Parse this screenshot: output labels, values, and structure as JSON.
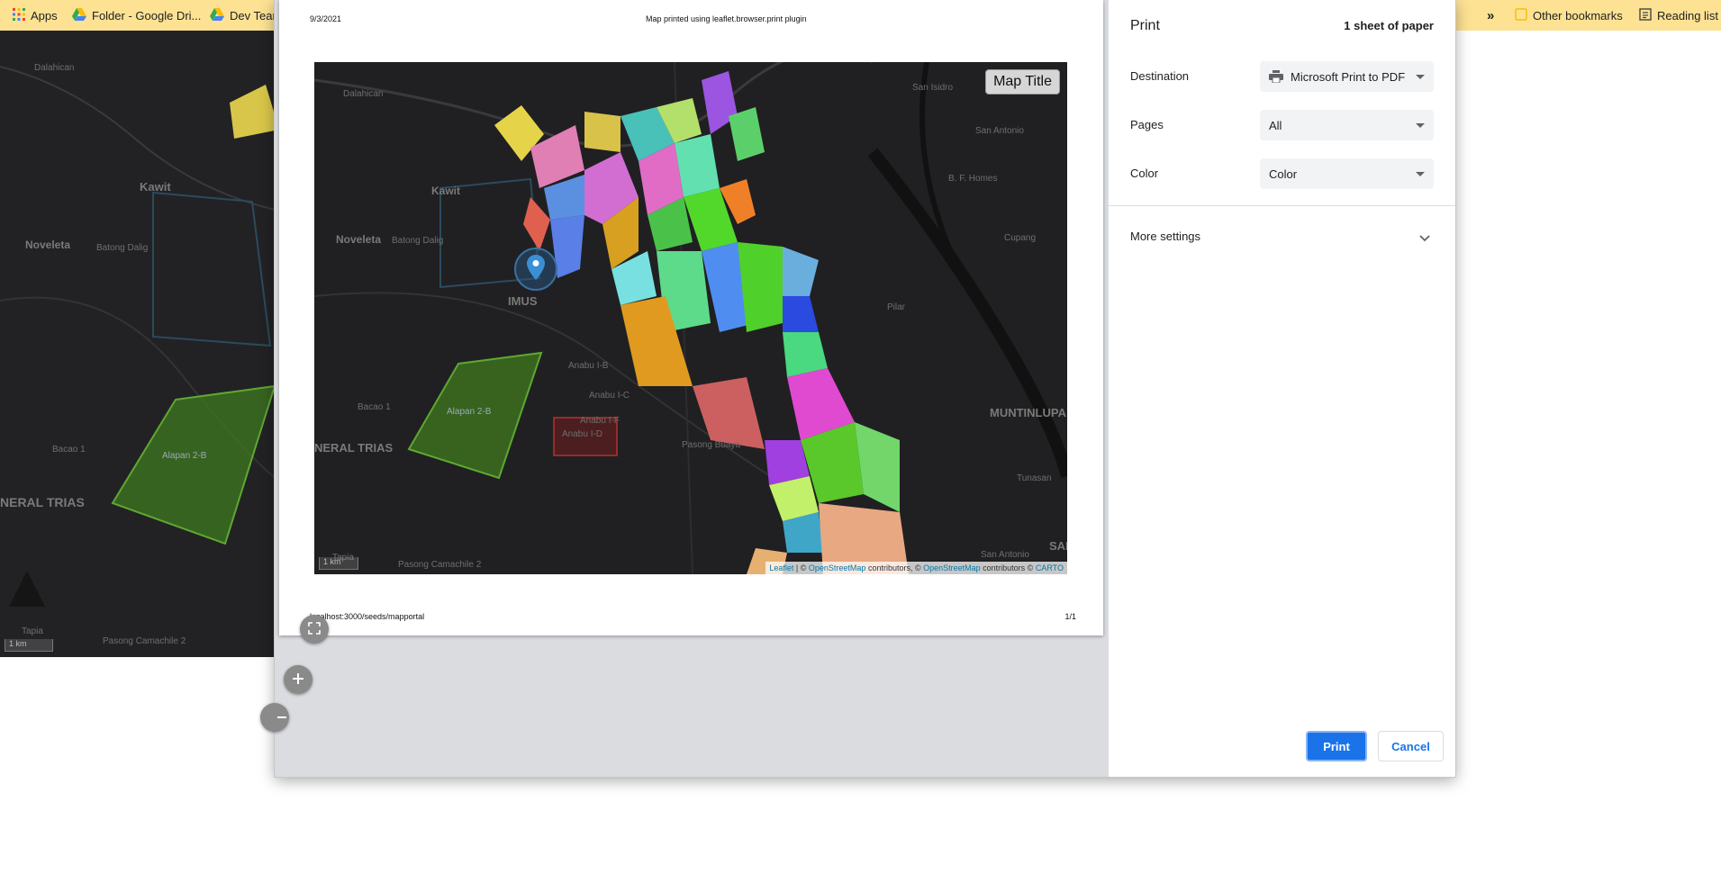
{
  "bookmarks": {
    "apps": "Apps",
    "folder": "Folder - Google Dri...",
    "dev_team": "Dev Team",
    "overflow": "»",
    "other": "Other bookmarks",
    "reading_list": "Reading list"
  },
  "background_map": {
    "labels": [
      "Dalahican",
      "Kawit",
      "Noveleta",
      "Batong Dalig",
      "Bacao 1",
      "Alapan 2-B",
      "NERAL TRIAS",
      "Tapia",
      "Pasong Camachile 2"
    ],
    "scale": "1 km"
  },
  "sheet": {
    "date": "9/3/2021",
    "header_title": "Map printed using leaflet.browser.print plugin",
    "footer_url": "localhost:3000/seeds/mapportal",
    "page_number": "1/1",
    "map": {
      "title_button": "Map Title",
      "scale": "1 km",
      "labels": [
        "Dalahican",
        "Kawit",
        "Noveleta",
        "Batong Dalig",
        "IMUS",
        "Anabu I-B",
        "Anabu I-C",
        "Anabu I-F",
        "Anabu I-D",
        "Alapan 2-B",
        "Bacao 1",
        "NERAL TRIAS",
        "Pasong Buaya",
        "Tapia",
        "Pasong Camachile 2",
        "San Isidro",
        "San Antonio",
        "B. F. Homes",
        "Cupang",
        "Pilar",
        "MUNTINLUPA",
        "Tunasan",
        "San Antonio",
        "SAN"
      ],
      "attribution": {
        "leaflet": "Leaflet",
        "sep1": " | © ",
        "osm1": "OpenStreetMap",
        "mid": " contributors, © ",
        "osm2": "OpenStreetMap",
        "mid2": " contributors © ",
        "carto": "CARTO"
      }
    }
  },
  "settings": {
    "title": "Print",
    "sheets": "1 sheet of paper",
    "destination_label": "Destination",
    "destination_value": "Microsoft Print to PDF",
    "pages_label": "Pages",
    "pages_value": "All",
    "color_label": "Color",
    "color_value": "Color",
    "more_settings": "More settings",
    "print_button": "Print",
    "cancel_button": "Cancel"
  },
  "colors": {
    "bookmark_bar": "#fde293",
    "accent": "#1a73e8",
    "map_background": "#202022",
    "polygon_green": "#5a9c2a",
    "highlight_red": "#b53030"
  }
}
